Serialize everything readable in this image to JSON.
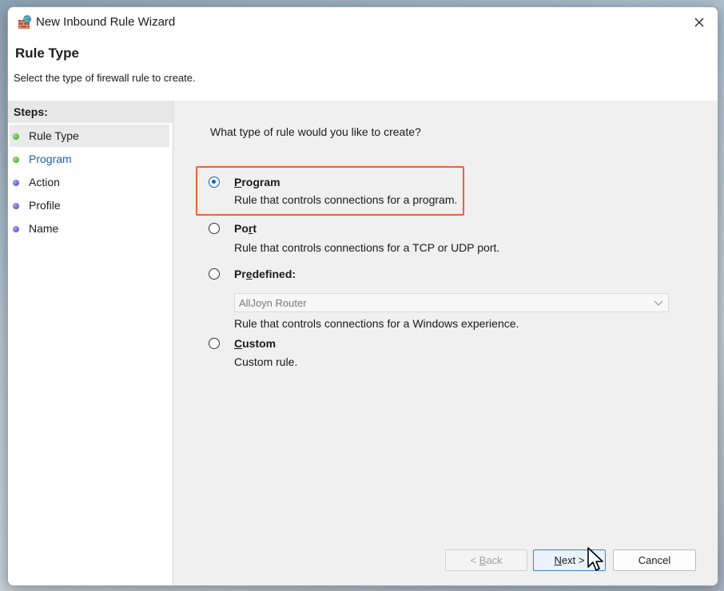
{
  "window": {
    "title": "New Inbound Rule Wizard",
    "close_icon": "close-icon",
    "app_icon": "firewall-icon"
  },
  "header": {
    "title": "Rule Type",
    "subtitle": "Select the type of firewall rule to create."
  },
  "steps": {
    "heading": "Steps:",
    "items": [
      {
        "label": "Rule Type",
        "state": "done",
        "dot_color": "#3a9b22"
      },
      {
        "label": "Program",
        "state": "current",
        "dot_color": "#3a9b22"
      },
      {
        "label": "Action",
        "state": "pending",
        "dot_color": "#4a3fbf"
      },
      {
        "label": "Profile",
        "state": "pending",
        "dot_color": "#4a3fbf"
      },
      {
        "label": "Name",
        "state": "pending",
        "dot_color": "#4a3fbf"
      }
    ]
  },
  "main": {
    "question": "What type of rule would you like to create?",
    "options": [
      {
        "label_pre": "",
        "label_ul": "P",
        "label_post": "rogram",
        "description": "Rule that controls connections for a program.",
        "selected": true
      },
      {
        "label_pre": "Po",
        "label_ul": "r",
        "label_post": "t",
        "description": "Rule that controls connections for a TCP or UDP port.",
        "selected": false
      },
      {
        "label_pre": "Pr",
        "label_ul": "e",
        "label_post": "defined:",
        "description": "Rule that controls connections for a Windows experience.",
        "selected": false
      },
      {
        "label_pre": "",
        "label_ul": "C",
        "label_post": "ustom",
        "description": "Custom rule.",
        "selected": false
      }
    ],
    "predefined_dropdown": {
      "value": "AllJoyn Router",
      "enabled": false
    },
    "highlight_color": "#e8643c"
  },
  "footer": {
    "back": {
      "pre": "< ",
      "ul": "B",
      "post": "ack",
      "enabled": false
    },
    "next": {
      "pre": "",
      "ul": "N",
      "post": "ext >",
      "enabled": true
    },
    "cancel": {
      "label": "Cancel",
      "enabled": true
    }
  }
}
